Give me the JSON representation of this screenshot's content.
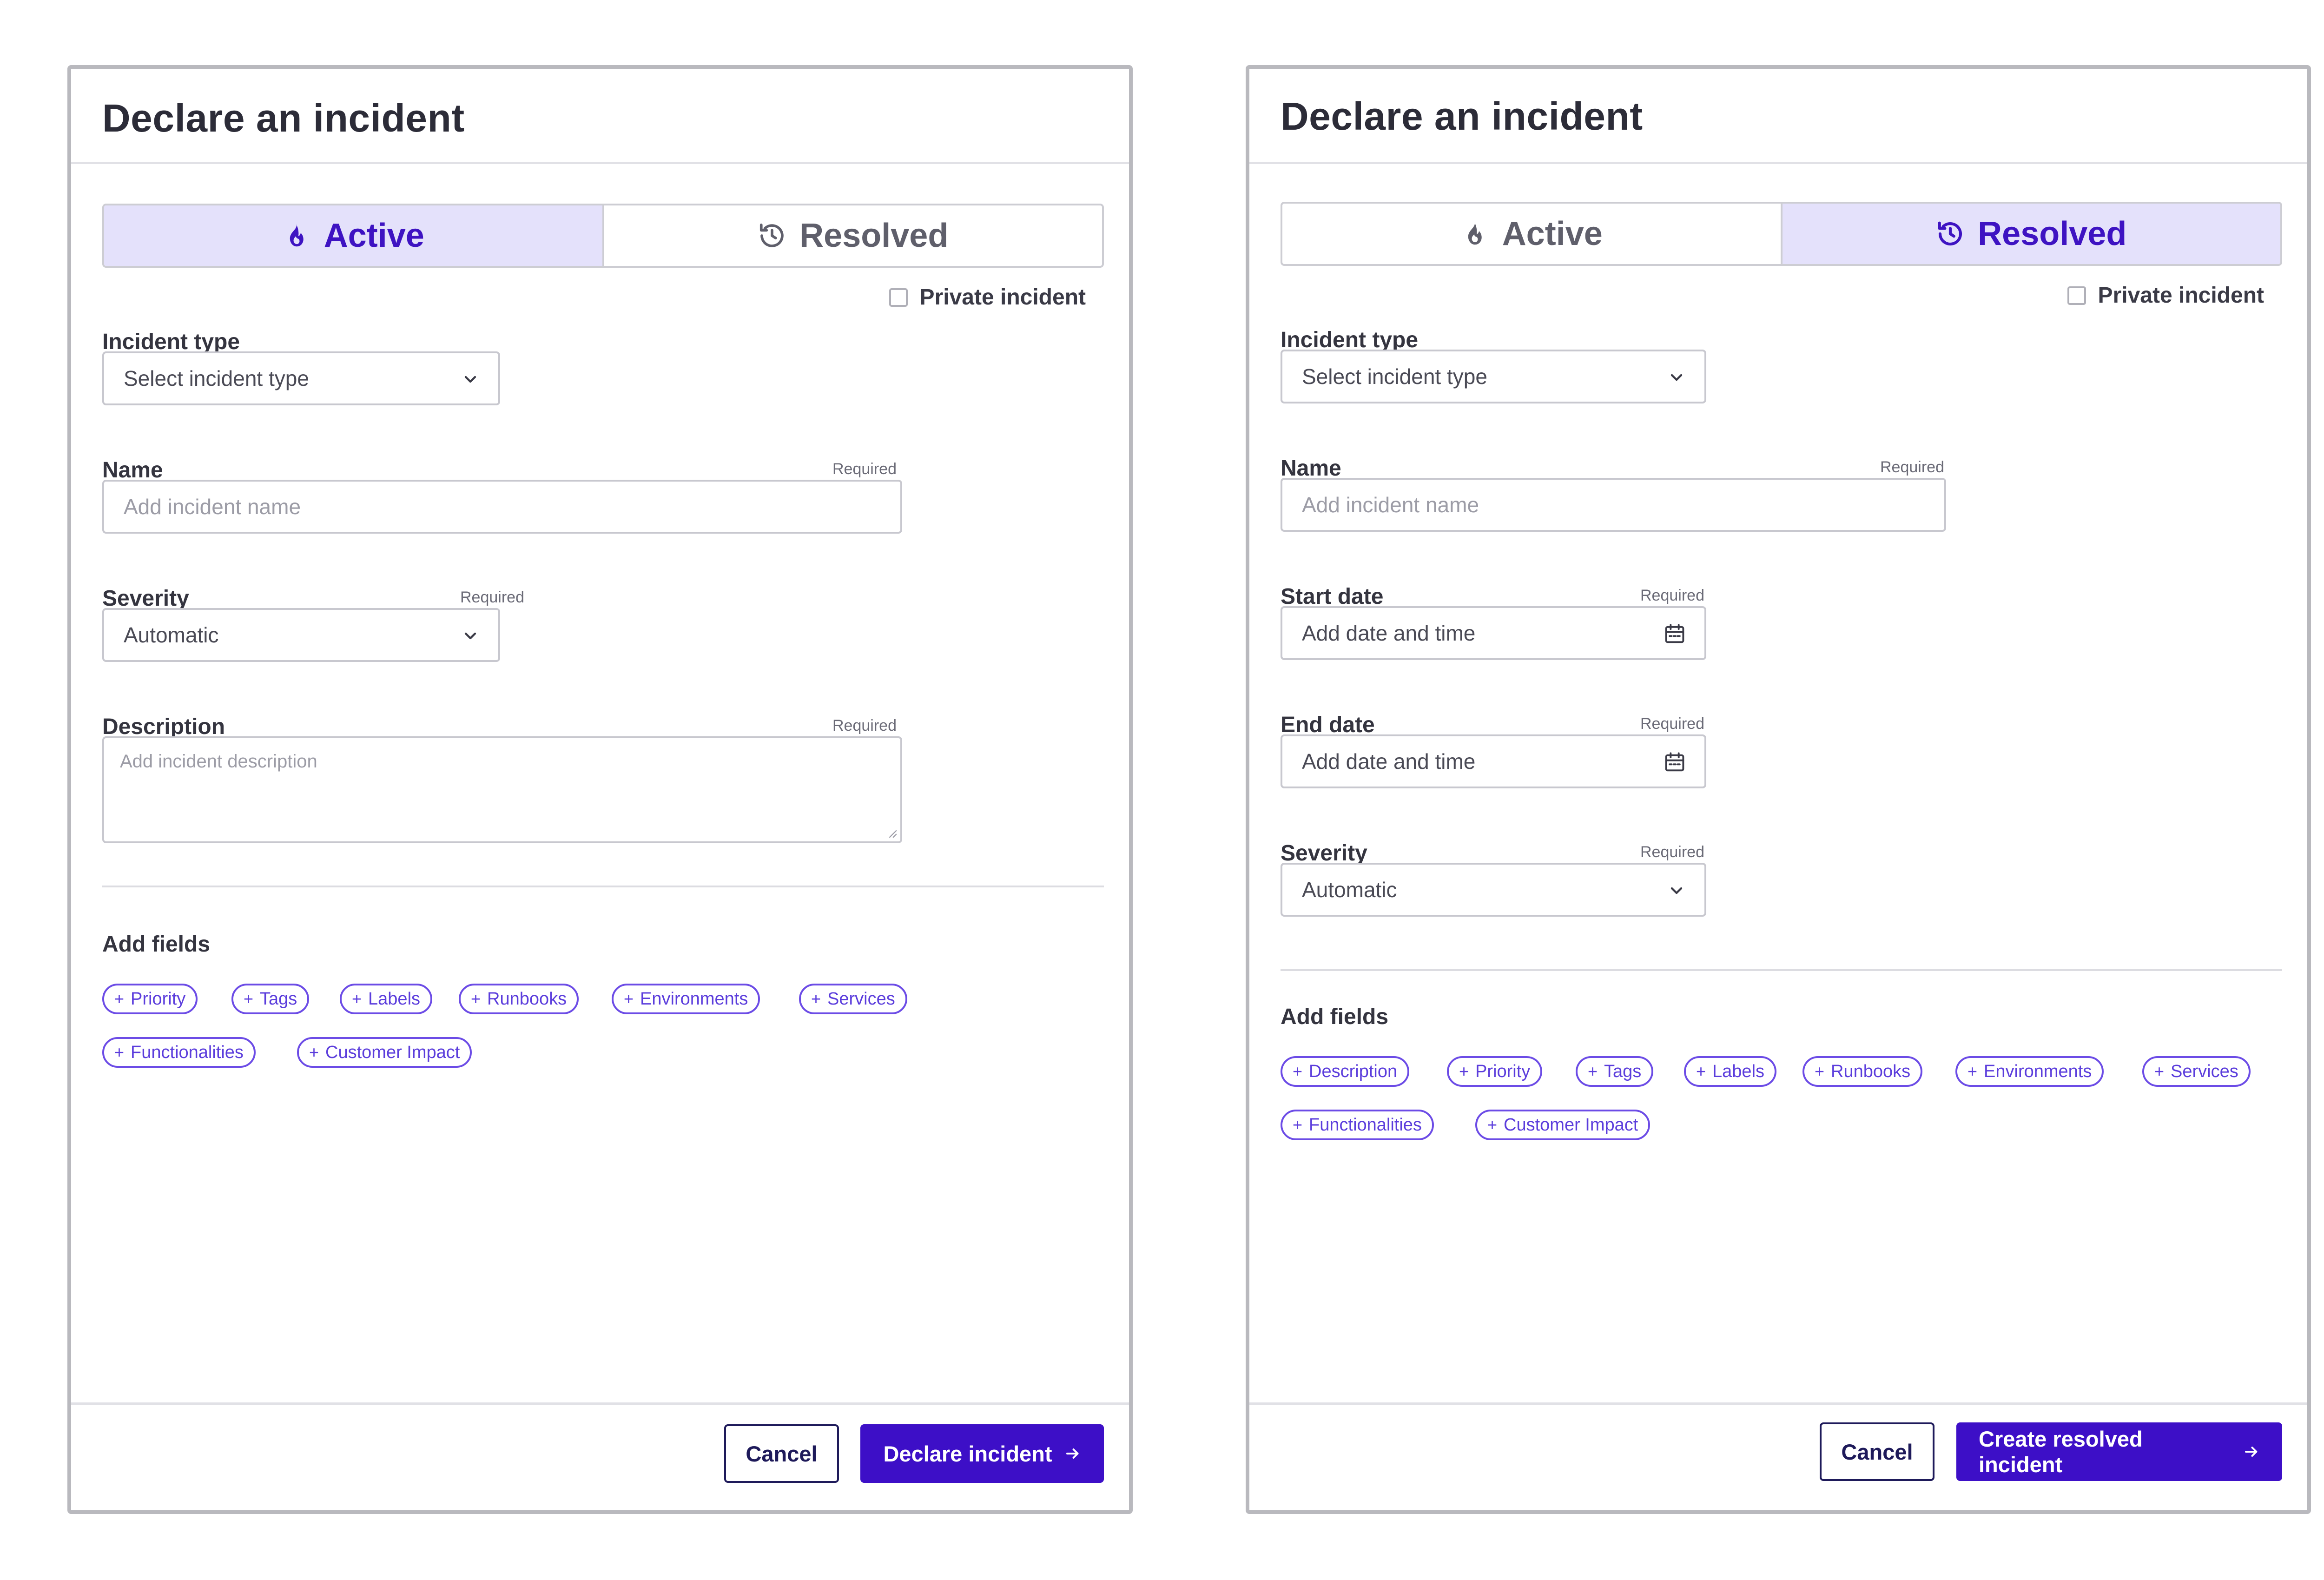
{
  "panels": [
    {
      "title": "Declare an incident",
      "tabs": {
        "active": "Active",
        "resolved": "Resolved",
        "selected": "active"
      },
      "private_label": "Private incident",
      "incident_type": {
        "label": "Incident type",
        "value": "Select incident type"
      },
      "name": {
        "label": "Name",
        "required": "Required",
        "placeholder": "Add incident name"
      },
      "severity": {
        "label": "Severity",
        "required": "Required",
        "value": "Automatic"
      },
      "description": {
        "label": "Description",
        "required": "Required",
        "placeholder": "Add incident description"
      },
      "add_fields": {
        "label": "Add fields",
        "chips": [
          "Priority",
          "Tags",
          "Labels",
          "Runbooks",
          "Environments",
          "Services",
          "Functionalities",
          "Customer Impact"
        ]
      },
      "footer": {
        "cancel": "Cancel",
        "submit": "Declare incident"
      }
    },
    {
      "title": "Declare an incident",
      "tabs": {
        "active": "Active",
        "resolved": "Resolved",
        "selected": "resolved"
      },
      "private_label": "Private incident",
      "incident_type": {
        "label": "Incident type",
        "value": "Select incident type"
      },
      "name": {
        "label": "Name",
        "required": "Required",
        "placeholder": "Add incident name"
      },
      "start_date": {
        "label": "Start date",
        "required": "Required",
        "placeholder": "Add date and time"
      },
      "end_date": {
        "label": "End date",
        "required": "Required",
        "placeholder": "Add date and time"
      },
      "severity": {
        "label": "Severity",
        "required": "Required",
        "value": "Automatic"
      },
      "add_fields": {
        "label": "Add fields",
        "chips": [
          "Description",
          "Priority",
          "Tags",
          "Labels",
          "Runbooks",
          "Environments",
          "Services",
          "Functionalities",
          "Customer Impact"
        ]
      },
      "footer": {
        "cancel": "Cancel",
        "submit": "Create resolved incident"
      }
    }
  ],
  "icons": {
    "active": "flame-icon",
    "resolved": "history-icon",
    "dropdown": "chevron-down-icon",
    "date": "calendar-icon",
    "submit": "arrow-right-icon"
  },
  "colors": {
    "accent": "#3d0fc7",
    "selected_tab_bg": "#e4e1fb",
    "chip": "#6c4ce6",
    "border": "#c8c8cf"
  }
}
